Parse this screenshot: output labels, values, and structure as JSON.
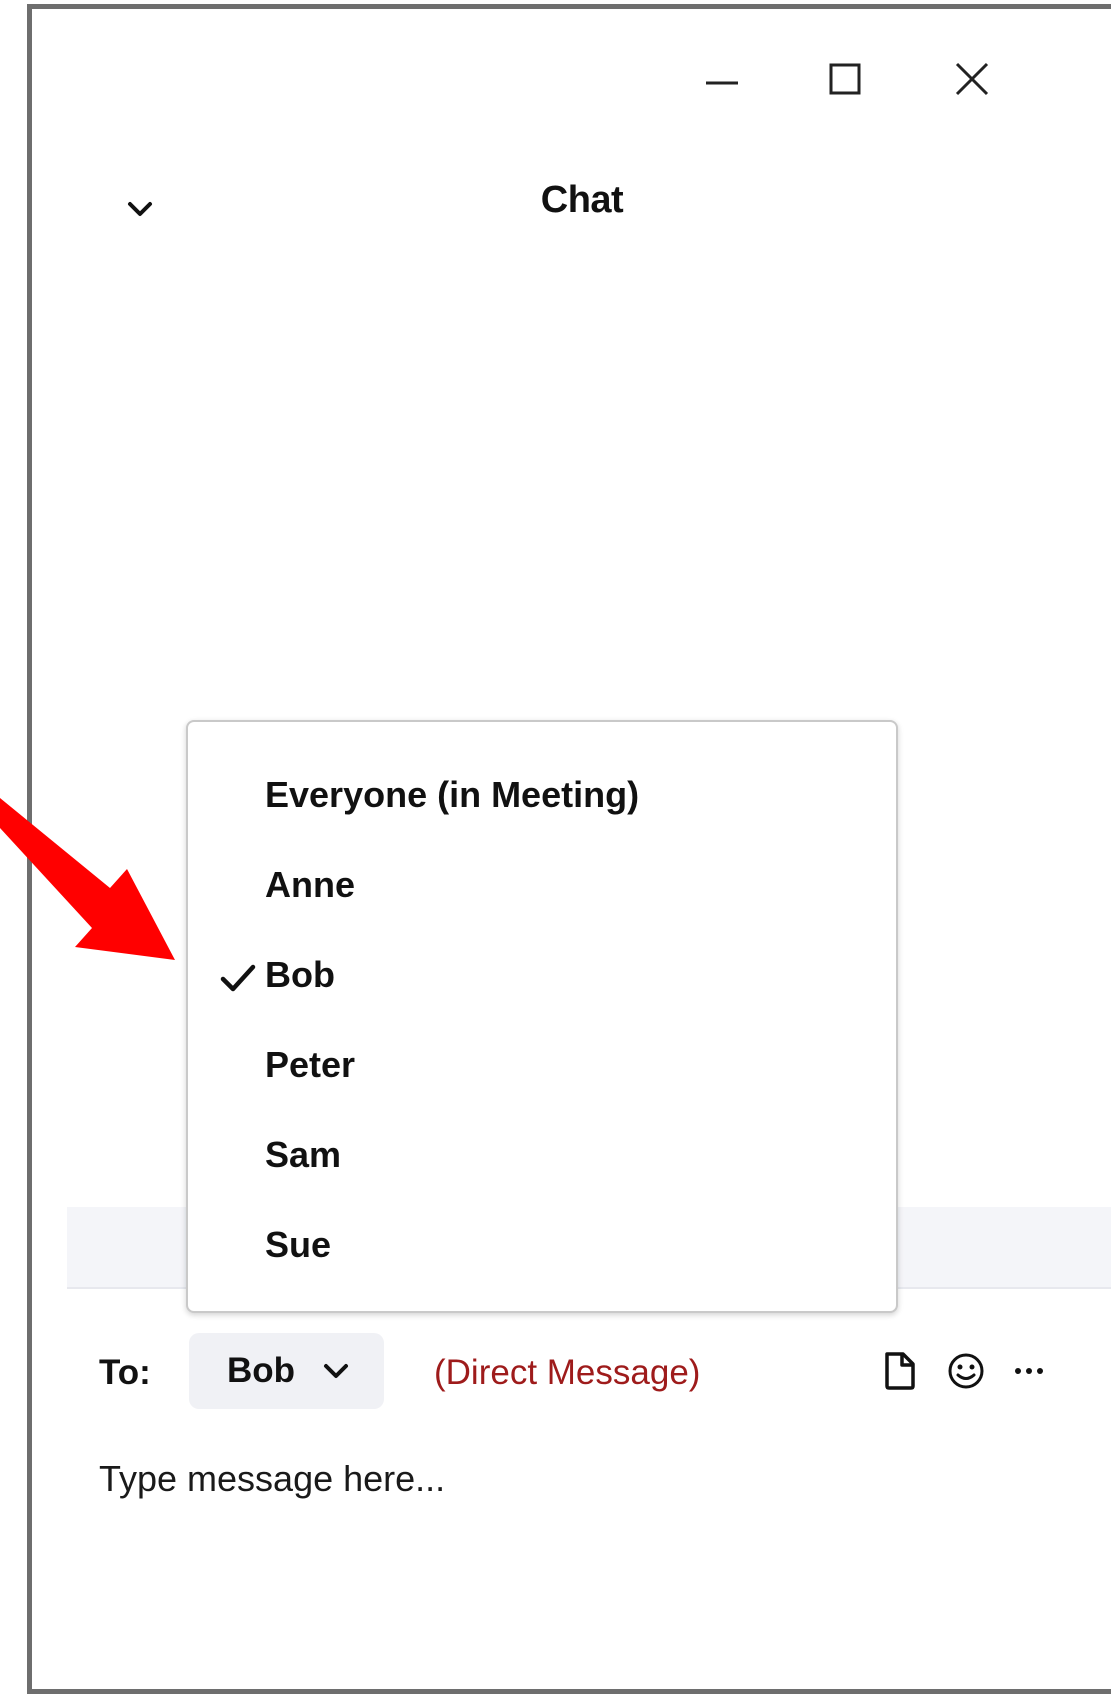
{
  "window": {
    "title": "Chat"
  },
  "recipient_menu": {
    "items": [
      {
        "label": "Everyone (in Meeting)",
        "checked": false
      },
      {
        "label": "Anne",
        "checked": false
      },
      {
        "label": "Bob",
        "checked": true
      },
      {
        "label": "Peter",
        "checked": false
      },
      {
        "label": "Sam",
        "checked": false
      },
      {
        "label": "Sue",
        "checked": false
      }
    ]
  },
  "compose": {
    "to_label": "To:",
    "recipient": "Bob",
    "mode_label": "(Direct Message)",
    "placeholder": "Type message here..."
  },
  "colors": {
    "direct_message": "#9e1b1b",
    "annotation_arrow": "#ff0000"
  },
  "icons": [
    "minimize-icon",
    "maximize-icon",
    "close-icon",
    "chevron-down-icon",
    "file-icon",
    "emoji-icon",
    "more-icon",
    "checkmark-icon",
    "annotation-arrow"
  ]
}
